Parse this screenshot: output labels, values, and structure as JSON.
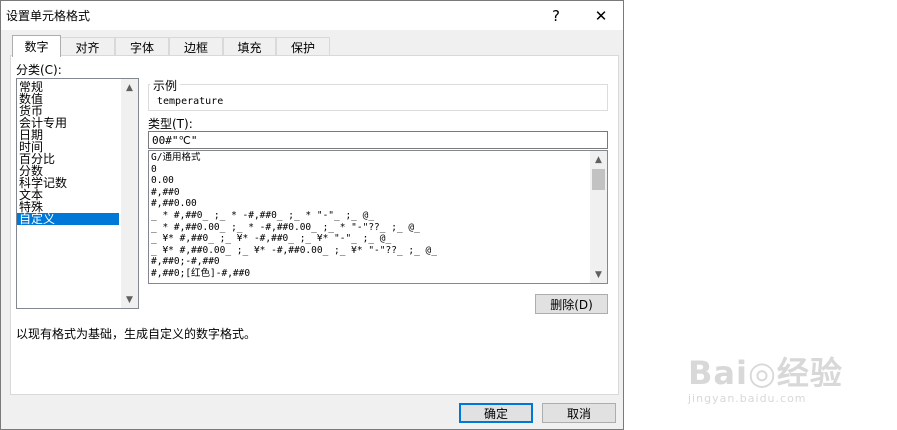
{
  "window": {
    "title": "设置单元格格式",
    "help_label": "?",
    "close_label": "✕"
  },
  "tabs": [
    {
      "label": "数字",
      "active": true
    },
    {
      "label": "对齐",
      "active": false
    },
    {
      "label": "字体",
      "active": false
    },
    {
      "label": "边框",
      "active": false
    },
    {
      "label": "填充",
      "active": false
    },
    {
      "label": "保护",
      "active": false
    }
  ],
  "category": {
    "label": "分类(C):",
    "items": [
      "常规",
      "数值",
      "货币",
      "会计专用",
      "日期",
      "时间",
      "百分比",
      "分数",
      "科学记数",
      "文本",
      "特殊",
      "自定义"
    ],
    "selected_index": 11
  },
  "sample": {
    "label": "示例",
    "value": "temperature"
  },
  "type_field": {
    "label": "类型(T):",
    "value": "00#\"℃\""
  },
  "format_list": [
    "G/通用格式",
    "0",
    "0.00",
    "#,##0",
    "#,##0.00",
    "_ * #,##0_ ;_ * -#,##0_ ;_ * \"-\"_ ;_ @_",
    "_ * #,##0.00_ ;_ * -#,##0.00_ ;_ * \"-\"??_ ;_ @_",
    "_ ¥* #,##0_ ;_ ¥* -#,##0_ ;_ ¥* \"-\"_ ;_ @_",
    "_ ¥* #,##0.00_ ;_ ¥* -#,##0.00_ ;_ ¥* \"-\"??_ ;_ @_",
    "#,##0;-#,##0",
    "#,##0;[红色]-#,##0"
  ],
  "buttons": {
    "delete_label": "删除(D)",
    "ok_label": "确定",
    "cancel_label": "取消"
  },
  "description": "以现有格式为基础，生成自定义的数字格式。",
  "watermark": {
    "text": "Bai◎经验",
    "url": "jingyan.baidu.com"
  },
  "colors": {
    "selection": "#0078d7",
    "dialog_bg": "#f0f0f0",
    "panel_bg": "#ffffff"
  }
}
